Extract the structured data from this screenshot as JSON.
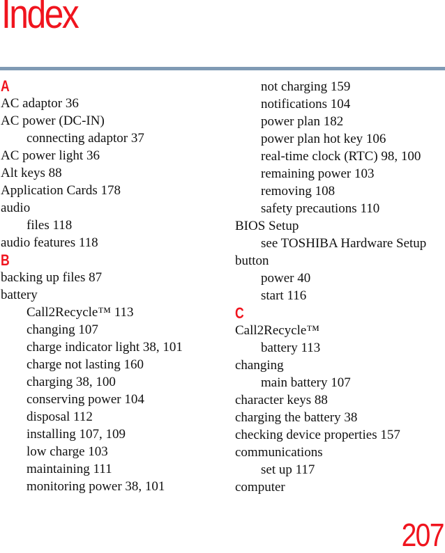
{
  "page": {
    "title": "Index",
    "page_number": "207",
    "accent_color": "#f0141e",
    "rule_color": "#7f9ab4"
  },
  "left_column": [
    {
      "type": "letter",
      "text": "A"
    },
    {
      "type": "entry",
      "level": 0,
      "text": "AC adaptor 36"
    },
    {
      "type": "entry",
      "level": 0,
      "text": "AC power (DC-IN)"
    },
    {
      "type": "entry",
      "level": 1,
      "text": "connecting adaptor 37"
    },
    {
      "type": "entry",
      "level": 0,
      "text": "AC power light 36"
    },
    {
      "type": "entry",
      "level": 0,
      "text": "Alt keys 88"
    },
    {
      "type": "entry",
      "level": 0,
      "text": "Application Cards 178"
    },
    {
      "type": "entry",
      "level": 0,
      "text": "audio"
    },
    {
      "type": "entry",
      "level": 1,
      "text": "files 118"
    },
    {
      "type": "entry",
      "level": 0,
      "text": "audio features 118"
    },
    {
      "type": "letter",
      "text": "B"
    },
    {
      "type": "entry",
      "level": 0,
      "text": "backing up files 87"
    },
    {
      "type": "entry",
      "level": 0,
      "text": "battery"
    },
    {
      "type": "entry",
      "level": 1,
      "text": "Call2Recycle™ 113"
    },
    {
      "type": "entry",
      "level": 1,
      "text": "changing 107"
    },
    {
      "type": "entry",
      "level": 1,
      "text": "charge indicator light 38, 101"
    },
    {
      "type": "entry",
      "level": 1,
      "text": "charge not lasting 160"
    },
    {
      "type": "entry",
      "level": 1,
      "text": "charging 38, 100"
    },
    {
      "type": "entry",
      "level": 1,
      "text": "conserving power 104"
    },
    {
      "type": "entry",
      "level": 1,
      "text": "disposal 112"
    },
    {
      "type": "entry",
      "level": 1,
      "text": "installing 107, 109"
    },
    {
      "type": "entry",
      "level": 1,
      "text": "low charge 103"
    },
    {
      "type": "entry",
      "level": 1,
      "text": "maintaining 111"
    },
    {
      "type": "entry",
      "level": 1,
      "text": "monitoring power 38, 101"
    }
  ],
  "right_column": [
    {
      "type": "entry",
      "level": 1,
      "text": "not charging 159"
    },
    {
      "type": "entry",
      "level": 1,
      "text": "notifications 104"
    },
    {
      "type": "entry",
      "level": 1,
      "text": "power plan 182"
    },
    {
      "type": "entry",
      "level": 1,
      "text": "power plan hot key 106"
    },
    {
      "type": "entry",
      "level": 1,
      "text": "real-time clock (RTC) 98, 100"
    },
    {
      "type": "entry",
      "level": 1,
      "text": "remaining power 103"
    },
    {
      "type": "entry",
      "level": 1,
      "text": "removing 108"
    },
    {
      "type": "entry",
      "level": 1,
      "text": "safety precautions 110"
    },
    {
      "type": "entry",
      "level": 0,
      "text": "BIOS Setup"
    },
    {
      "type": "entry",
      "level": 1,
      "text": "see TOSHIBA Hardware Setup"
    },
    {
      "type": "entry",
      "level": 0,
      "text": "button"
    },
    {
      "type": "entry",
      "level": 1,
      "text": "power 40"
    },
    {
      "type": "entry",
      "level": 1,
      "text": "start 116"
    },
    {
      "type": "letter",
      "text": "C"
    },
    {
      "type": "entry",
      "level": 0,
      "text": "Call2Recycle™"
    },
    {
      "type": "entry",
      "level": 1,
      "text": "battery 113"
    },
    {
      "type": "entry",
      "level": 0,
      "text": "changing"
    },
    {
      "type": "entry",
      "level": 1,
      "text": "main battery 107"
    },
    {
      "type": "entry",
      "level": 0,
      "text": "character keys 88"
    },
    {
      "type": "entry",
      "level": 0,
      "text": "charging the battery 38"
    },
    {
      "type": "entry",
      "level": 0,
      "text": "checking device properties 157"
    },
    {
      "type": "entry",
      "level": 0,
      "text": "communications"
    },
    {
      "type": "entry",
      "level": 1,
      "text": "set up 117"
    },
    {
      "type": "entry",
      "level": 0,
      "text": "computer"
    }
  ]
}
